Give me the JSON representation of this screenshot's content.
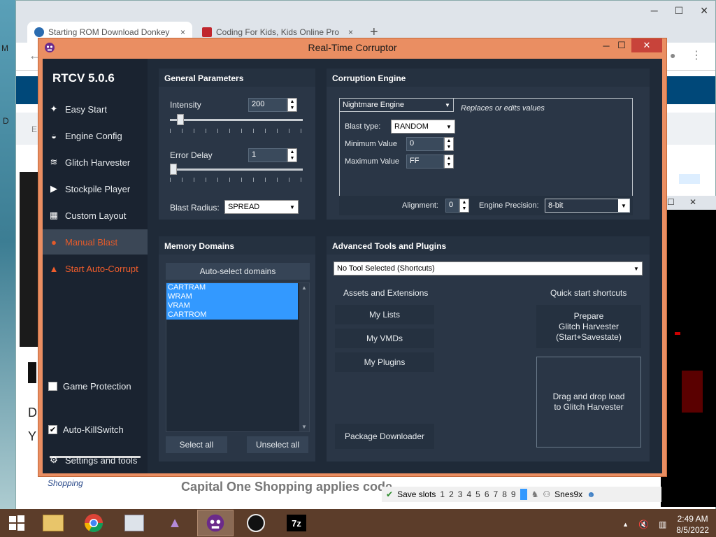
{
  "browser": {
    "tabs": [
      {
        "title": "Starting ROM Download Donkey",
        "close": "×"
      },
      {
        "title": "Coding For Kids, Kids Online Pro",
        "close": "×"
      }
    ],
    "new_tab": "+",
    "ghost_texts": [
      "M",
      "D",
      "E",
      "D",
      "Y"
    ],
    "shopping_label": "Shopping",
    "coshop_text": "Capital One Shopping applies code"
  },
  "rtc": {
    "title": "Real-Time Corruptor",
    "brand": "RTCV 5.0.6",
    "nav": [
      {
        "label": "Easy Start",
        "icon": "✦"
      },
      {
        "label": "Engine Config",
        "icon": "◒"
      },
      {
        "label": "Glitch Harvester",
        "icon": "≋"
      },
      {
        "label": "Stockpile Player",
        "icon": "▶"
      },
      {
        "label": "Custom Layout",
        "icon": "▦"
      },
      {
        "label": "Manual Blast",
        "icon": "●"
      },
      {
        "label": "Start Auto-Corrupt",
        "icon": "▲"
      }
    ],
    "game_protection": "Game Protection",
    "auto_killswitch": "Auto-KillSwitch",
    "settings": "Settings and tools",
    "general": {
      "title": "General Parameters",
      "intensity_label": "Intensity",
      "intensity_value": "200",
      "intensity_fraction": 0.08,
      "error_delay_label": "Error Delay",
      "error_delay_value": "1",
      "error_delay_fraction": 0.0,
      "blast_radius_label": "Blast Radius:",
      "blast_radius_value": "SPREAD"
    },
    "engine": {
      "title": "Corruption Engine",
      "engine_value": "Nightmare Engine",
      "engine_desc": "Replaces or edits values",
      "blast_type_label": "Blast type:",
      "blast_type_value": "RANDOM",
      "min_label": "Minimum Value",
      "min_value": "0",
      "max_label": "Maximum Value",
      "max_value": "FF",
      "alignment_label": "Alignment:",
      "alignment_value": "0",
      "precision_label": "Engine Precision:",
      "precision_value": "8-bit"
    },
    "memory": {
      "title": "Memory Domains",
      "auto_select": "Auto-select domains",
      "domains": [
        "CARTRAM",
        "WRAM",
        "VRAM",
        "CARTROM"
      ],
      "select_all": "Select all",
      "unselect_all": "Unselect all"
    },
    "tools": {
      "title": "Advanced Tools and Plugins",
      "tool_dropdown": "No Tool Selected (Shortcuts)",
      "assets_title": "Assets and Extensions",
      "my_lists": "My Lists",
      "my_vmds": "My VMDs",
      "my_plugins": "My Plugins",
      "package_downloader": "Package Downloader",
      "quick_title": "Quick start shortcuts",
      "prepare": "Prepare\nGlitch Harvester\n(Start+Savestate)",
      "drag_drop": "Drag and drop load\nto Glitch Harvester"
    }
  },
  "snes": {
    "save_slots": "Save slots",
    "slots": [
      "1",
      "2",
      "3",
      "4",
      "5",
      "6",
      "7",
      "8",
      "9"
    ],
    "app": "Snes9x"
  },
  "taskbar": {
    "time": "2:49 AM",
    "date": "8/5/2022"
  },
  "colors": {
    "rtc_frame": "#ea8e62",
    "rtc_bg": "#1f2a38",
    "accent_orange": "#e45a2a",
    "selection": "#3399ff"
  }
}
